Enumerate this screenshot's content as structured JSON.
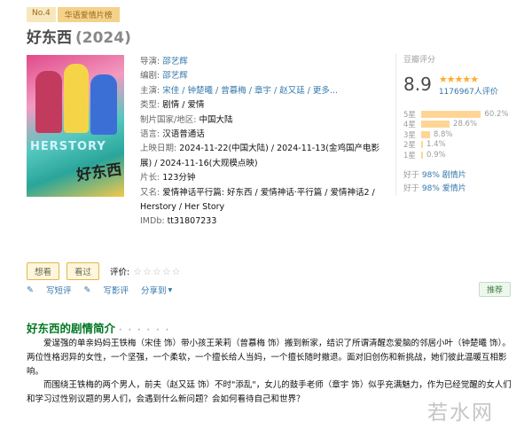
{
  "rank": {
    "no": "No.4",
    "tag": "华语爱情片榜"
  },
  "title": {
    "name": "好东西",
    "year": "(2024)"
  },
  "poster": {
    "english": "HERSTORY",
    "calligraphy": "好东西"
  },
  "info": {
    "director_label": "导演:",
    "director": "邵艺辉",
    "writer_label": "编剧:",
    "writer": "邵艺辉",
    "cast_label": "主演:",
    "cast": "宋佳 / 钟楚曦 / 曾慕梅 / 章宇 / 赵又廷 / 更多...",
    "genre_label": "类型:",
    "genre": "剧情 / 爱情",
    "country_label": "制片国家/地区:",
    "country": "中国大陆",
    "language_label": "语言:",
    "language": "汉语普通话",
    "release_label": "上映日期:",
    "release": "2024-11-22(中国大陆) / 2024-11-13(金鸡国产电影展) / 2024-11-16(大规模点映)",
    "runtime_label": "片长:",
    "runtime": "123分钟",
    "aka_label": "又名:",
    "aka": "爱情神话平行篇: 好东西 / 爱情神话·平行篇 / 爱情神话2 / Herstory / Her Story",
    "imdb_label": "IMDb:",
    "imdb": "tt31807233"
  },
  "rating": {
    "label": "豆瓣评分",
    "score": "8.9",
    "stars": "★★★★★",
    "count": "1176967人评价",
    "distribution": [
      {
        "star": "5星",
        "percent": "60.2%",
        "value": 60.2
      },
      {
        "star": "4星",
        "percent": "28.6%",
        "value": 28.6
      },
      {
        "star": "3星",
        "percent": "8.8%",
        "value": 8.8
      },
      {
        "star": "2星",
        "percent": "1.4%",
        "value": 1.4
      },
      {
        "star": "1星",
        "percent": "0.9%",
        "value": 0.9
      }
    ],
    "better_than": [
      {
        "prefix": "好于",
        "value": "98% 剧情片"
      },
      {
        "prefix": "好于",
        "value": "98% 爱情片"
      }
    ]
  },
  "actions": {
    "want": "想看",
    "seen": "看过",
    "rate_label": "评价:",
    "rate_stars": "☆☆☆☆☆",
    "short_review": "写短评",
    "long_review": "写影评",
    "share": "分享到",
    "recommend": "推荐"
  },
  "intro": {
    "title": "好东西的剧情简介",
    "dots": "· · · · · ·",
    "p1": "爱逞强的单亲妈妈王铁梅（宋佳 饰）带小孩王茉莉（曾慕梅 饰）搬到新家，结识了所谓清醒恋爱脑的邻居小叶（钟楚曦 饰）。两位性格迥异的女性，一个坚强，一个柔软，一个擅长给人当妈，一个擅长随时撤退。面对旧创伤和新挑战，她们彼此温暖互相影响。",
    "p2": "而围绕王铁梅的两个男人，前夫（赵又廷 饰）不时\"添乱\"，女儿的鼓手老师（章宇 饰）似乎充满魅力，作为已经觉醒的女人们和学习过性别议题的男人们，会遇到什么新问题？会如何看待自己和世界？"
  },
  "watermark": "若水网"
}
